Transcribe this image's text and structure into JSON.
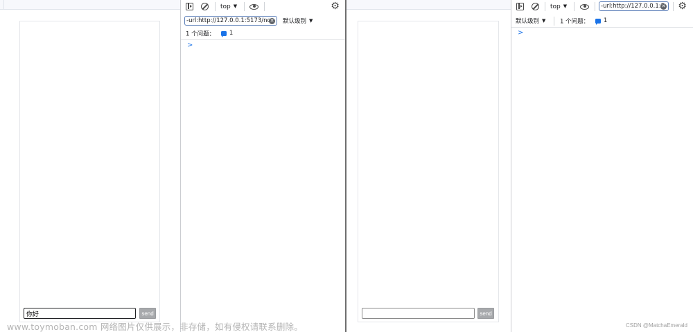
{
  "left_window": {
    "chat": {
      "input_value": "你好",
      "send_label": "send"
    },
    "devtools": {
      "context": "top",
      "filter_value": "-url:http://127.0.0.1:5173/noc",
      "level_label": "默认级别",
      "issues_label": "1 个问题：",
      "issues_count": "1",
      "prompt": ">"
    }
  },
  "right_window": {
    "chat": {
      "input_value": "",
      "send_label": "send"
    },
    "devtools": {
      "context": "top",
      "filter_value": "-url:http://127.0.0.1:5",
      "level_label": "默认级别",
      "issues_label": "1 个问题：",
      "issues_count": "1",
      "prompt": ">"
    }
  },
  "icons": {
    "sidebar": "show-console-sidebar-icon",
    "clear": "clear-console-icon",
    "eye": "live-expression-eye-icon",
    "gear": "settings-gear-icon",
    "message": "message-icon",
    "filter_clear": "clear-filter-icon"
  },
  "colors": {
    "accent_blue": "#1a73e8",
    "send_button": "#a7a9ac"
  },
  "watermark": "www.toymoban.com 网络图片仅供展示，非存储，如有侵权请联系删除。",
  "credit": "CSDN @MatchaEmerald"
}
